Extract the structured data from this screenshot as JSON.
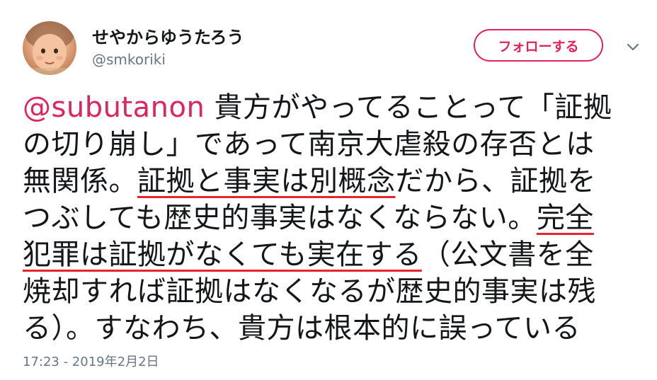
{
  "user": {
    "display_name": "せやからゆうたろう",
    "handle": "@smkoriki",
    "avatar_icon": "baby-photo-avatar"
  },
  "follow_button": {
    "label": "フォローする",
    "color": "#e0245e"
  },
  "menu_icon": "chevron-down-icon",
  "tweet": {
    "line1": {
      "mention": "@subutanon",
      "text": " 貴方がやってることって「証拠"
    },
    "line2": {
      "text": "の切り崩し」であって南京大虐殺の存否とは"
    },
    "line3": {
      "text_before": "無関係。",
      "underlined": "証拠と事実は別概念",
      "text_after": "だから、証拠を"
    },
    "line4": {
      "text_before": "つぶしても歴史的事実はなくならない。",
      "underlined": "完全"
    },
    "line5": {
      "underlined": "犯罪は証拠がなくても実在する",
      "text_after": "（公文書を全"
    },
    "line6": {
      "text": "焼却すれば証拠はなくなるが歴史的事実は残"
    },
    "line7": {
      "text": "る）。すなわち、貴方は根本的に誤っている"
    },
    "underline_color": "#e8222e",
    "mention_color": "#e0245e"
  },
  "timestamp": "17:23 - 2019年2月2日"
}
